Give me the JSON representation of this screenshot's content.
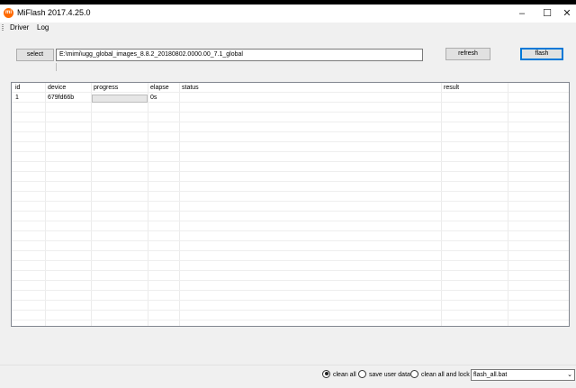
{
  "window": {
    "title": "MiFlash 2017.4.25.0",
    "icon": "mi-logo-icon"
  },
  "menu": [
    "Driver",
    "Log"
  ],
  "toolbar": {
    "select_label": "select",
    "path_value": "E:\\mimi\\ugg_global_images_8.8.2_20180802.0000.00_7.1_global",
    "refresh_label": "refresh",
    "flash_label": "flash"
  },
  "table": {
    "columns": [
      "id",
      "device",
      "progress",
      "elapse",
      "status",
      "result"
    ],
    "rows": [
      {
        "id": "1",
        "device": "679fd66b",
        "progress": 0,
        "elapse": "0s",
        "status": "",
        "result": ""
      }
    ]
  },
  "options": {
    "modes": [
      {
        "label": "clean all",
        "selected": true
      },
      {
        "label": "save user data",
        "selected": false
      },
      {
        "label": "clean all and lock",
        "selected": false
      }
    ],
    "script": "flash_all.bat"
  },
  "colors": {
    "app_icon": "#ff6a00",
    "default_button_border": "#0078d7"
  }
}
